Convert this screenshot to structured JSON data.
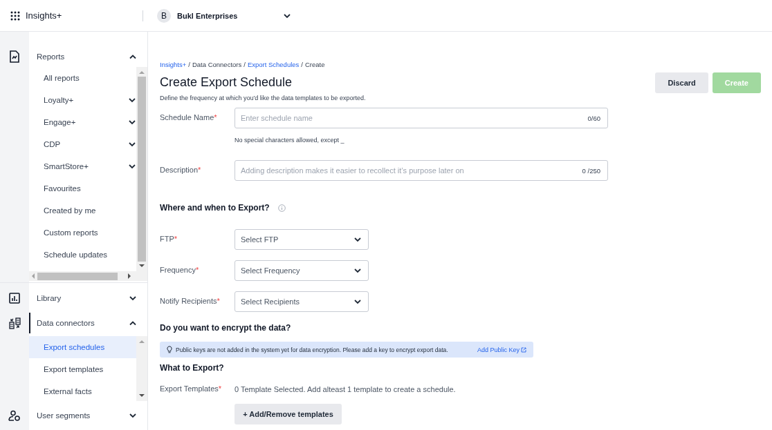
{
  "header": {
    "app_name": "Insights+",
    "org": {
      "initial": "B",
      "name": "Bukl Enterprises"
    }
  },
  "sidebar": {
    "sections": [
      {
        "label": "Reports",
        "expanded": true,
        "active": false,
        "items": [
          {
            "label": "All reports",
            "kind": "link",
            "selected": false
          },
          {
            "label": "Loyalty+",
            "kind": "group",
            "selected": false
          },
          {
            "label": "Engage+",
            "kind": "group",
            "selected": false
          },
          {
            "label": "CDP",
            "kind": "group",
            "selected": false
          },
          {
            "label": "SmartStore+",
            "kind": "group",
            "selected": false
          },
          {
            "label": "Favourites",
            "kind": "link",
            "selected": false
          },
          {
            "label": "Created by me",
            "kind": "link",
            "selected": false
          },
          {
            "label": "Custom reports",
            "kind": "link",
            "selected": false
          },
          {
            "label": "Schedule updates",
            "kind": "link",
            "selected": false
          }
        ]
      },
      {
        "label": "Library",
        "expanded": false,
        "active": false
      },
      {
        "label": "Data connectors",
        "expanded": true,
        "active": true,
        "items": [
          {
            "label": "Export schedules",
            "kind": "link",
            "selected": true
          },
          {
            "label": "Export templates",
            "kind": "link",
            "selected": false
          },
          {
            "label": "External facts",
            "kind": "link",
            "selected": false
          }
        ]
      },
      {
        "label": "User segments",
        "expanded": false,
        "active": false
      }
    ]
  },
  "breadcrumb_separator": "/",
  "breadcrumb": [
    {
      "label": "Insights+",
      "link": true
    },
    {
      "label": "Data Connectors",
      "link": false
    },
    {
      "label": "Export Schedules",
      "link": true
    },
    {
      "label": "Create",
      "link": false
    }
  ],
  "title": "Create Export Schedule",
  "subtitle": "Define the frequency at which you'd like the data templates to be exported.",
  "actions": [
    {
      "label": "Discard",
      "kind": "secondary",
      "disabled": false
    },
    {
      "label": "Create",
      "kind": "primary",
      "disabled": true
    }
  ],
  "fields": [
    {
      "label": "Schedule Name",
      "required_mark": "*",
      "placeholder": "Enter schedule name",
      "counter": "0/60",
      "hint": "No special characters allowed, except _"
    },
    {
      "label": "Description",
      "required_mark": "*",
      "placeholder": "Adding description makes it easier to recollect it’s purpose later on",
      "counter": "0 /250"
    }
  ],
  "where_heading": "Where and when to Export?",
  "selects": [
    {
      "label": "FTP",
      "required_mark": "*",
      "placeholder": "Select FTP"
    },
    {
      "label": "Frequency",
      "required_mark": "*",
      "placeholder": "Select Frequency"
    },
    {
      "label": "Notify Recipients",
      "required_mark": "*",
      "placeholder": "Select Recipients"
    }
  ],
  "encrypt_heading": "Do you want to encrypt the data?",
  "banner": {
    "text": "Public keys are not added in the system yet for data encryption. Please add a key to encrypt export data.",
    "link": "Add Public Key"
  },
  "what_heading": "What to Export?",
  "export_templates": {
    "label": "Export Templates",
    "required_mark": "*",
    "text": "0 Template Selected. Add alteast 1 template to create a schedule.",
    "button": "+ Add/Remove templates"
  }
}
